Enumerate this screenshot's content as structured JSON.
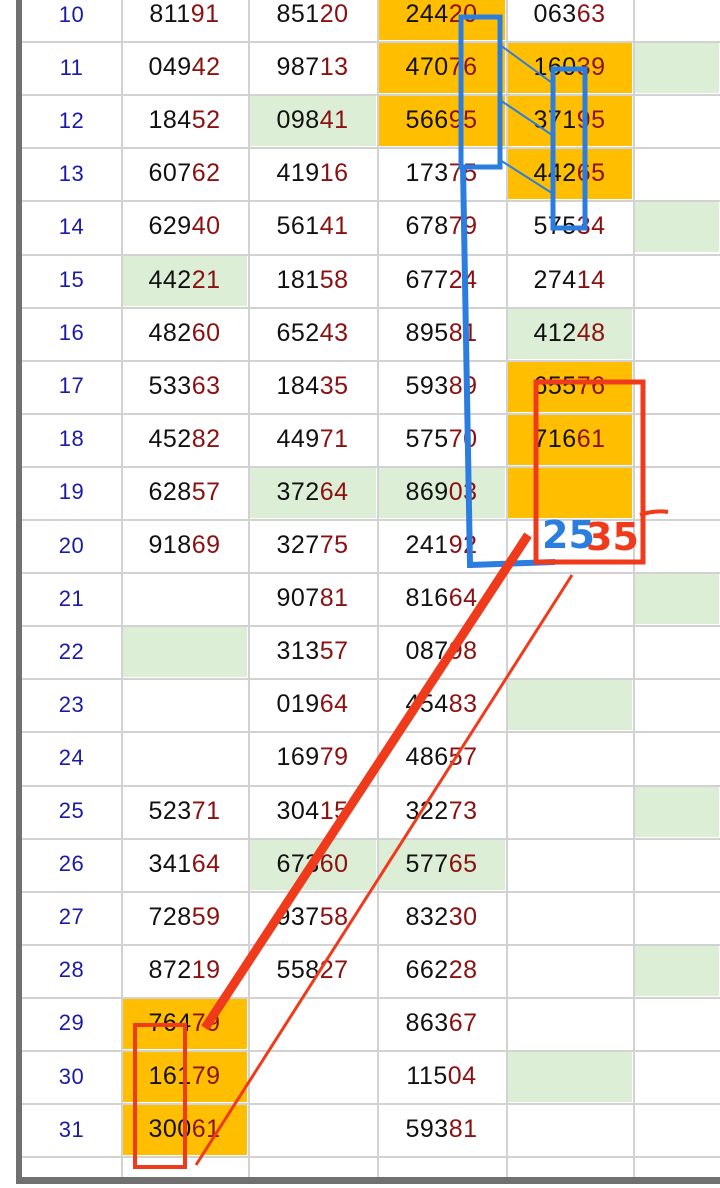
{
  "colors": {
    "highlight_orange": "#ffbf00",
    "highlight_green": "#dcefd6",
    "day_number": "#1a1aa8",
    "digits_lead": "#111111",
    "digits_tail": "#8b1010",
    "annotation_blue": "#2b7de0",
    "annotation_red": "#f03a1c"
  },
  "annotation": {
    "handwritten_number": "25",
    "handwritten_number_red": "35"
  },
  "rows": [
    {
      "day": "10",
      "cols": [
        "81191",
        "85120",
        "24420",
        "06363",
        ""
      ],
      "fills": [
        "",
        "",
        "orange",
        "",
        ""
      ]
    },
    {
      "day": "11",
      "cols": [
        "04942",
        "98713",
        "47076",
        "16039",
        ""
      ],
      "fills": [
        "",
        "",
        "orange",
        "orange",
        "green"
      ]
    },
    {
      "day": "12",
      "cols": [
        "18452",
        "09841",
        "56695",
        "37195",
        ""
      ],
      "fills": [
        "",
        "green",
        "orange",
        "orange",
        ""
      ]
    },
    {
      "day": "13",
      "cols": [
        "60762",
        "41916",
        "17375",
        "44265",
        ""
      ],
      "fills": [
        "",
        "",
        "",
        "orange",
        ""
      ]
    },
    {
      "day": "14",
      "cols": [
        "62940",
        "56141",
        "67879",
        "57534",
        ""
      ],
      "fills": [
        "",
        "",
        "",
        "",
        "green"
      ]
    },
    {
      "day": "15",
      "cols": [
        "44221",
        "18158",
        "67724",
        "27414",
        ""
      ],
      "fills": [
        "green",
        "",
        "",
        "",
        ""
      ]
    },
    {
      "day": "16",
      "cols": [
        "48260",
        "65243",
        "89581",
        "41248",
        ""
      ],
      "fills": [
        "",
        "",
        "",
        "green",
        ""
      ]
    },
    {
      "day": "17",
      "cols": [
        "53363",
        "18435",
        "59389",
        "65576",
        ""
      ],
      "fills": [
        "",
        "",
        "",
        "orange",
        ""
      ]
    },
    {
      "day": "18",
      "cols": [
        "45282",
        "44971",
        "57570",
        "71661",
        ""
      ],
      "fills": [
        "",
        "",
        "",
        "orange",
        ""
      ]
    },
    {
      "day": "19",
      "cols": [
        "62857",
        "37264",
        "86903",
        "",
        ""
      ],
      "fills": [
        "",
        "green",
        "green",
        "orange",
        ""
      ]
    },
    {
      "day": "20",
      "cols": [
        "91869",
        "32775",
        "24192",
        "",
        ""
      ],
      "fills": [
        "",
        "",
        "",
        "",
        ""
      ]
    },
    {
      "day": "21",
      "cols": [
        "",
        "90781",
        "81664",
        "",
        ""
      ],
      "fills": [
        "",
        "",
        "",
        "",
        "green"
      ]
    },
    {
      "day": "22",
      "cols": [
        "",
        "31357",
        "08798",
        "",
        ""
      ],
      "fills": [
        "green",
        "",
        "",
        "",
        ""
      ]
    },
    {
      "day": "23",
      "cols": [
        "",
        "01964",
        "45483",
        "",
        ""
      ],
      "fills": [
        "",
        "",
        "",
        "green",
        ""
      ]
    },
    {
      "day": "24",
      "cols": [
        "",
        "16979",
        "48657",
        "",
        ""
      ],
      "fills": [
        "",
        "",
        "",
        "",
        ""
      ]
    },
    {
      "day": "25",
      "cols": [
        "52371",
        "30415",
        "32273",
        "",
        ""
      ],
      "fills": [
        "",
        "",
        "",
        "",
        "green"
      ]
    },
    {
      "day": "26",
      "cols": [
        "34164",
        "67360",
        "57765",
        "",
        ""
      ],
      "fills": [
        "",
        "green",
        "green",
        "",
        ""
      ]
    },
    {
      "day": "27",
      "cols": [
        "72859",
        "93758",
        "83230",
        "",
        ""
      ],
      "fills": [
        "",
        "",
        "",
        "",
        ""
      ]
    },
    {
      "day": "28",
      "cols": [
        "87219",
        "55827",
        "66228",
        "",
        ""
      ],
      "fills": [
        "",
        "",
        "",
        "",
        "green"
      ]
    },
    {
      "day": "29",
      "cols": [
        "76479",
        "",
        "86367",
        "",
        ""
      ],
      "fills": [
        "orange",
        "",
        "",
        "",
        ""
      ]
    },
    {
      "day": "30",
      "cols": [
        "16179",
        "",
        "11504",
        "",
        ""
      ],
      "fills": [
        "orange",
        "",
        "",
        "green",
        ""
      ]
    },
    {
      "day": "31",
      "cols": [
        "30061",
        "",
        "59381",
        "",
        ""
      ],
      "fills": [
        "orange",
        "",
        "",
        "",
        ""
      ]
    }
  ]
}
